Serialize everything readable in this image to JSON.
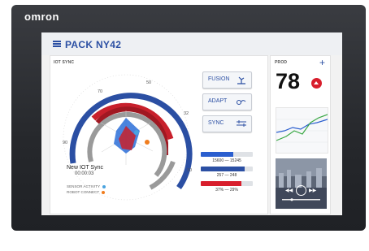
{
  "device": {
    "brand": "omron"
  },
  "header": {
    "title": "PACK NY42"
  },
  "main": {
    "section_label": "IOT SYNC",
    "gauge_ticks": [
      "70",
      "50",
      "32",
      "90",
      "10"
    ],
    "sync_name": "New IOT Sync",
    "sync_time": "00:00:03",
    "legend": [
      {
        "label": "SENSOR ACTIVITY",
        "color": "#4aa3df"
      },
      {
        "label": "ROBOT CONNECT",
        "color": "#f07d1e"
      }
    ],
    "buttons": [
      {
        "label": "FUSION",
        "icon": "robot-arm-icon"
      },
      {
        "label": "ADAPT",
        "icon": "adapt-icon"
      },
      {
        "label": "SYNC",
        "icon": "sync-icon"
      }
    ],
    "bars": [
      {
        "text": "15600 — 15245",
        "fill": 0.62,
        "color": "#2b5fcf"
      },
      {
        "text": "257 — 248",
        "fill": 0.84,
        "color": "#2b4fa3"
      },
      {
        "text": "37% — 29%",
        "fill": 0.78,
        "color": "#d81e2c"
      }
    ]
  },
  "side": {
    "label": "PROD",
    "value": "78",
    "add_icon": "plus-icon",
    "alert_icon": "alert-up-icon"
  },
  "colors": {
    "accent": "#2b4fa3",
    "red": "#d81e2c",
    "green": "#3aa845"
  }
}
